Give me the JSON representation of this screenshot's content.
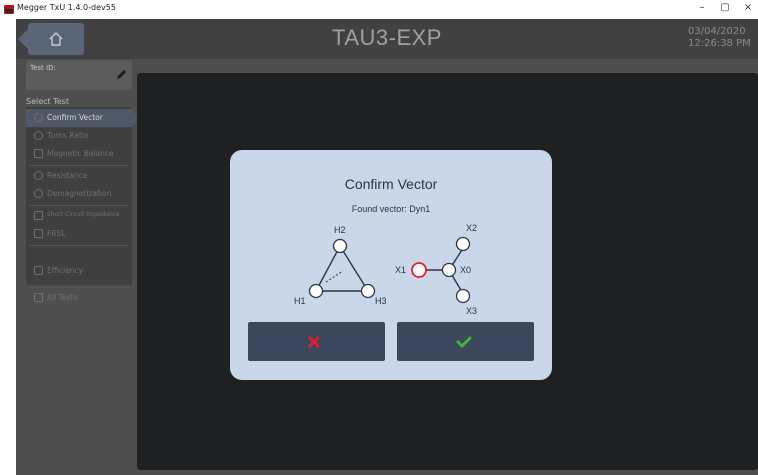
{
  "window": {
    "title": "Megger TxU 1.4.0-dev55",
    "controls": [
      "–",
      "▢",
      "×"
    ]
  },
  "header": {
    "title": "TAU3-EXP",
    "date": "03/04/2020",
    "time": "12:26:38 PM"
  },
  "sidebar": {
    "test_id_label": "Test ID:",
    "select_test_label": "Select Test",
    "items": [
      {
        "label": "Confirm Vector",
        "icon": "search-icon",
        "active": true
      },
      {
        "label": "Turns Ratio",
        "icon": "coil-icon"
      },
      {
        "label": "Magnetic Balance",
        "icon": "grid-icon"
      },
      {
        "label": "Resistance",
        "icon": "omega-icon"
      },
      {
        "label": "Demagnetization",
        "icon": "magnet-icon"
      },
      {
        "label": "Short Circuit Impedance",
        "icon": "impedance-icon"
      },
      {
        "label": "FRSL",
        "icon": "frsl-icon"
      },
      {
        "label": "Efficiency",
        "icon": "efficiency-icon"
      },
      {
        "label": "All Tests",
        "icon": "list-icon"
      }
    ]
  },
  "dialog": {
    "title": "Confirm Vector",
    "subtitle": "Found vector: Dyn1",
    "primary_labels": {
      "top": "H2",
      "left": "H1",
      "right": "H3"
    },
    "secondary_labels": {
      "x1": "X1",
      "x0": "X0",
      "x2": "X2",
      "x3": "X3"
    },
    "cancel_icon": "x-icon",
    "confirm_icon": "check-icon",
    "colors": {
      "cancel": "#d8202f",
      "confirm": "#44b43a",
      "highlight": "#e0202a"
    }
  }
}
